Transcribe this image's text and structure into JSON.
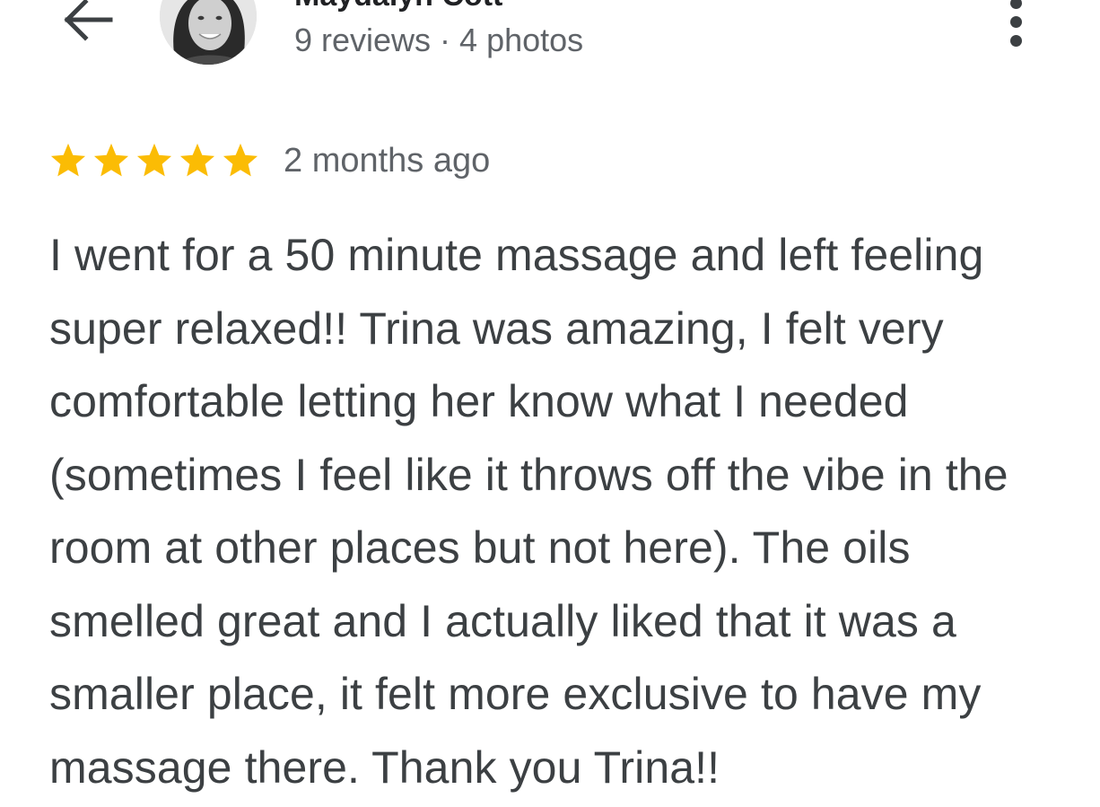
{
  "header": {
    "author_name": "Maydalyn Cott",
    "author_meta": "9 reviews · 4 photos"
  },
  "icons": {
    "back": "arrow-left-icon",
    "more": "more-vert-icon",
    "star": "star-icon"
  },
  "review": {
    "rating": 5,
    "rating_max": 5,
    "time": "2 months ago",
    "text": "I went for a 50 minute massage and left feeling super relaxed!! Trina was amazing, I felt very comfortable letting her know what I needed (sometimes I feel like it throws off the vibe in the room at other places but not here). The oils smelled great and I actually liked that it was a smaller place, it felt more exclusive to have my massage there. Thank you Trina!!"
  },
  "colors": {
    "star": "#FBBC04",
    "text": "#3C4043",
    "secondary_text": "#5F6368"
  }
}
